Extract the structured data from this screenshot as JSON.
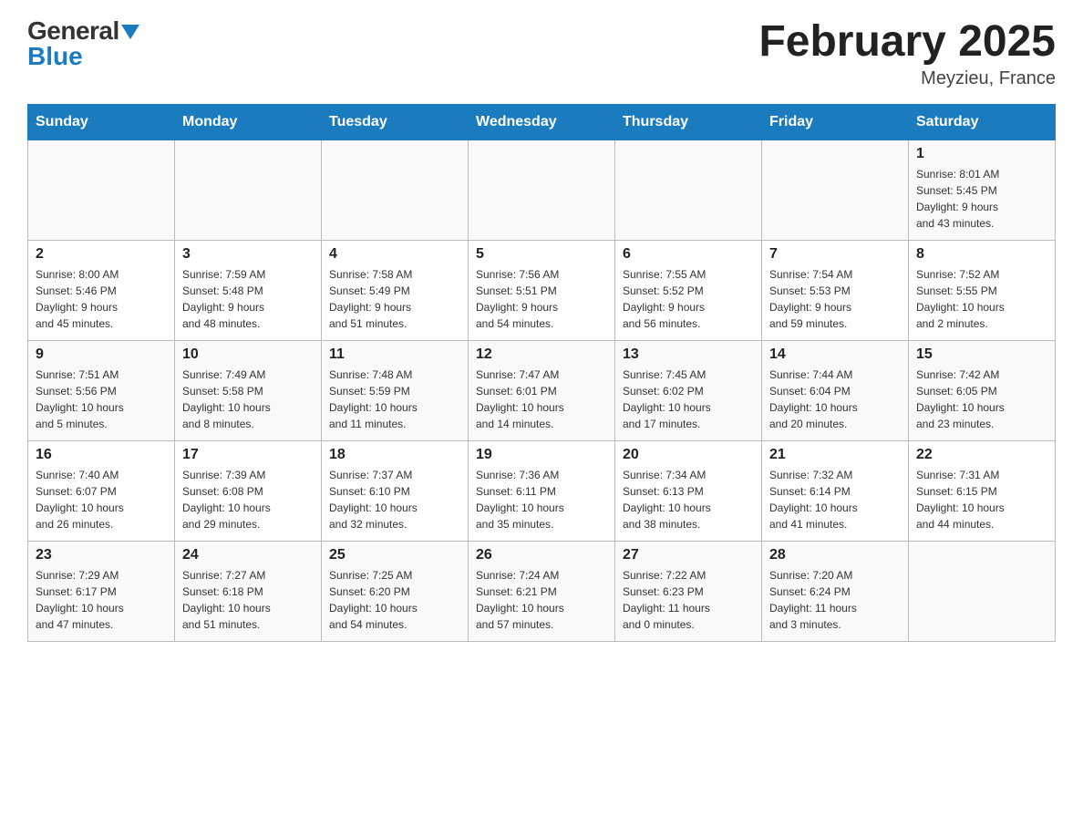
{
  "header": {
    "logo": {
      "general_text": "General",
      "blue_text": "Blue"
    },
    "title": "February 2025",
    "location": "Meyzieu, France"
  },
  "weekdays": [
    "Sunday",
    "Monday",
    "Tuesday",
    "Wednesday",
    "Thursday",
    "Friday",
    "Saturday"
  ],
  "weeks": [
    {
      "days": [
        {
          "number": "",
          "info": ""
        },
        {
          "number": "",
          "info": ""
        },
        {
          "number": "",
          "info": ""
        },
        {
          "number": "",
          "info": ""
        },
        {
          "number": "",
          "info": ""
        },
        {
          "number": "",
          "info": ""
        },
        {
          "number": "1",
          "info": "Sunrise: 8:01 AM\nSunset: 5:45 PM\nDaylight: 9 hours\nand 43 minutes."
        }
      ]
    },
    {
      "days": [
        {
          "number": "2",
          "info": "Sunrise: 8:00 AM\nSunset: 5:46 PM\nDaylight: 9 hours\nand 45 minutes."
        },
        {
          "number": "3",
          "info": "Sunrise: 7:59 AM\nSunset: 5:48 PM\nDaylight: 9 hours\nand 48 minutes."
        },
        {
          "number": "4",
          "info": "Sunrise: 7:58 AM\nSunset: 5:49 PM\nDaylight: 9 hours\nand 51 minutes."
        },
        {
          "number": "5",
          "info": "Sunrise: 7:56 AM\nSunset: 5:51 PM\nDaylight: 9 hours\nand 54 minutes."
        },
        {
          "number": "6",
          "info": "Sunrise: 7:55 AM\nSunset: 5:52 PM\nDaylight: 9 hours\nand 56 minutes."
        },
        {
          "number": "7",
          "info": "Sunrise: 7:54 AM\nSunset: 5:53 PM\nDaylight: 9 hours\nand 59 minutes."
        },
        {
          "number": "8",
          "info": "Sunrise: 7:52 AM\nSunset: 5:55 PM\nDaylight: 10 hours\nand 2 minutes."
        }
      ]
    },
    {
      "days": [
        {
          "number": "9",
          "info": "Sunrise: 7:51 AM\nSunset: 5:56 PM\nDaylight: 10 hours\nand 5 minutes."
        },
        {
          "number": "10",
          "info": "Sunrise: 7:49 AM\nSunset: 5:58 PM\nDaylight: 10 hours\nand 8 minutes."
        },
        {
          "number": "11",
          "info": "Sunrise: 7:48 AM\nSunset: 5:59 PM\nDaylight: 10 hours\nand 11 minutes."
        },
        {
          "number": "12",
          "info": "Sunrise: 7:47 AM\nSunset: 6:01 PM\nDaylight: 10 hours\nand 14 minutes."
        },
        {
          "number": "13",
          "info": "Sunrise: 7:45 AM\nSunset: 6:02 PM\nDaylight: 10 hours\nand 17 minutes."
        },
        {
          "number": "14",
          "info": "Sunrise: 7:44 AM\nSunset: 6:04 PM\nDaylight: 10 hours\nand 20 minutes."
        },
        {
          "number": "15",
          "info": "Sunrise: 7:42 AM\nSunset: 6:05 PM\nDaylight: 10 hours\nand 23 minutes."
        }
      ]
    },
    {
      "days": [
        {
          "number": "16",
          "info": "Sunrise: 7:40 AM\nSunset: 6:07 PM\nDaylight: 10 hours\nand 26 minutes."
        },
        {
          "number": "17",
          "info": "Sunrise: 7:39 AM\nSunset: 6:08 PM\nDaylight: 10 hours\nand 29 minutes."
        },
        {
          "number": "18",
          "info": "Sunrise: 7:37 AM\nSunset: 6:10 PM\nDaylight: 10 hours\nand 32 minutes."
        },
        {
          "number": "19",
          "info": "Sunrise: 7:36 AM\nSunset: 6:11 PM\nDaylight: 10 hours\nand 35 minutes."
        },
        {
          "number": "20",
          "info": "Sunrise: 7:34 AM\nSunset: 6:13 PM\nDaylight: 10 hours\nand 38 minutes."
        },
        {
          "number": "21",
          "info": "Sunrise: 7:32 AM\nSunset: 6:14 PM\nDaylight: 10 hours\nand 41 minutes."
        },
        {
          "number": "22",
          "info": "Sunrise: 7:31 AM\nSunset: 6:15 PM\nDaylight: 10 hours\nand 44 minutes."
        }
      ]
    },
    {
      "days": [
        {
          "number": "23",
          "info": "Sunrise: 7:29 AM\nSunset: 6:17 PM\nDaylight: 10 hours\nand 47 minutes."
        },
        {
          "number": "24",
          "info": "Sunrise: 7:27 AM\nSunset: 6:18 PM\nDaylight: 10 hours\nand 51 minutes."
        },
        {
          "number": "25",
          "info": "Sunrise: 7:25 AM\nSunset: 6:20 PM\nDaylight: 10 hours\nand 54 minutes."
        },
        {
          "number": "26",
          "info": "Sunrise: 7:24 AM\nSunset: 6:21 PM\nDaylight: 10 hours\nand 57 minutes."
        },
        {
          "number": "27",
          "info": "Sunrise: 7:22 AM\nSunset: 6:23 PM\nDaylight: 11 hours\nand 0 minutes."
        },
        {
          "number": "28",
          "info": "Sunrise: 7:20 AM\nSunset: 6:24 PM\nDaylight: 11 hours\nand 3 minutes."
        },
        {
          "number": "",
          "info": ""
        }
      ]
    }
  ]
}
